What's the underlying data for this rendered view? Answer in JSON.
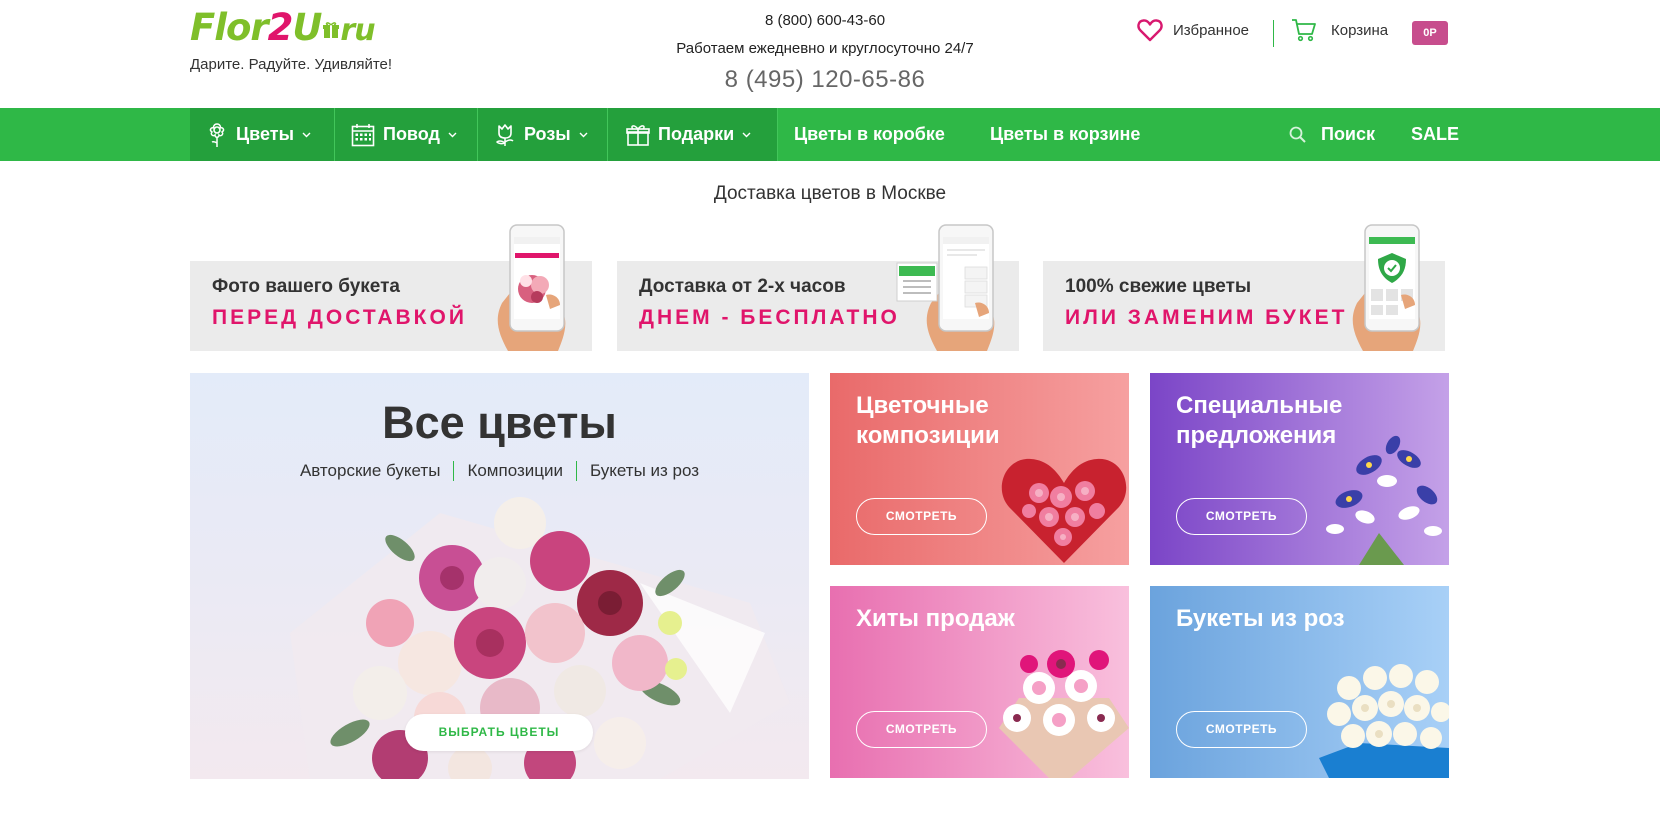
{
  "header": {
    "logo": {
      "part1": "Flor",
      "part2": "2",
      "part3": "U",
      "part4": "ru"
    },
    "tagline": "Дарите. Радуйте. Удивляйте!",
    "phone_main": "8 (800) 600-43-60",
    "hours": "Работаем ежедневно и круглосуточно 24/7",
    "phone_moscow": "8 (495) 120-65-86",
    "favorites_label": "Избранное",
    "cart_label": "Корзина",
    "cart_badge": "0Р"
  },
  "nav": {
    "items": [
      {
        "label": "Цветы",
        "icon": "flower-icon",
        "dropdown": true
      },
      {
        "label": "Повод",
        "icon": "calendar-icon",
        "dropdown": true
      },
      {
        "label": "Розы",
        "icon": "rose-icon",
        "dropdown": true
      },
      {
        "label": "Подарки",
        "icon": "gift-icon",
        "dropdown": true
      },
      {
        "label": "Цветы в коробке"
      },
      {
        "label": "Цветы в корзине"
      }
    ],
    "search_label": "Поиск",
    "sale_label": "SALE"
  },
  "main": {
    "title": "Доставка цветов в Москве",
    "features": [
      {
        "line1": "Фото вашего букета",
        "line2": "ПЕРЕД ДОСТАВКОЙ"
      },
      {
        "line1": "Доставка от 2-х часов",
        "line2": "ДНЕМ - БЕСПЛАТНО"
      },
      {
        "line1": "100% свежие цветы",
        "line2": "ИЛИ ЗАМЕНИМ БУКЕТ"
      }
    ],
    "all_flowers": {
      "title": "Все цветы",
      "links": [
        "Авторские букеты",
        "Композиции",
        "Букеты из роз"
      ],
      "button": "ВЫБРАТЬ ЦВЕТЫ"
    },
    "tiles": [
      {
        "title_line1": "Цветочные",
        "title_line2": "композиции",
        "button": "СМОТРЕТЬ"
      },
      {
        "title_line1": "Специальные",
        "title_line2": "предложения",
        "button": "СМОТРЕТЬ"
      },
      {
        "title_line1": "Хиты продаж",
        "title_line2": "",
        "button": "СМОТРЕТЬ"
      },
      {
        "title_line1": "Букеты из роз",
        "title_line2": "",
        "button": "СМОТРЕТЬ"
      }
    ]
  },
  "colors": {
    "brand_green": "#2fb847",
    "brand_pink": "#e0156b",
    "cart_badge": "#c74d8d"
  }
}
